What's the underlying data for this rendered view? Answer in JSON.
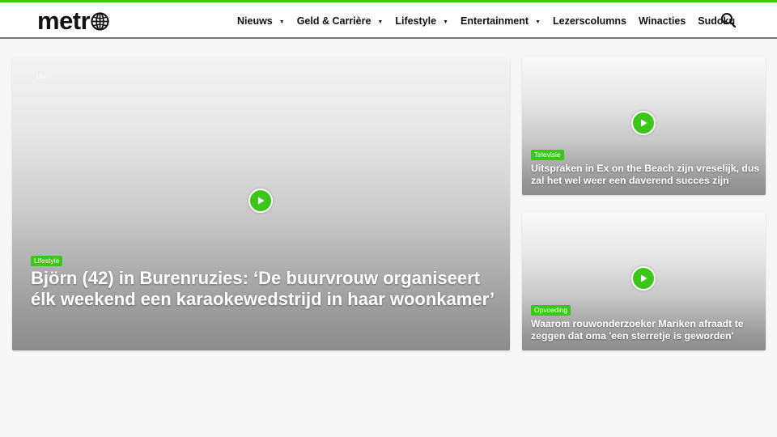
{
  "header": {
    "logo_text": "metr",
    "nav": [
      {
        "label": "Nieuws",
        "dropdown": true
      },
      {
        "label": "Geld & Carrière",
        "dropdown": true
      },
      {
        "label": "Lifestyle",
        "dropdown": true
      },
      {
        "label": "Entertainment",
        "dropdown": true
      },
      {
        "label": "Lezerscolumns",
        "dropdown": false
      },
      {
        "label": "Winacties",
        "dropdown": false
      },
      {
        "label": "Sudoku",
        "dropdown": false
      }
    ],
    "search_icon": "search-icon",
    "caret": "▼"
  },
  "colors": {
    "accent": "#3cc51a",
    "header_bg": "#ffffff",
    "page_bg": "#f7f7f7"
  },
  "main": {
    "featured": {
      "overlay_text": "Uw",
      "category": "Lifestyle",
      "title": "Björn (42) in Burenruzies: ‘De buurvrouw organiseert élk weekend een karaokewedstrijd in haar woonkamer’",
      "icon": "play-icon"
    },
    "side": [
      {
        "category": "Televisie",
        "title": "Uitspraken in Ex on the Beach zijn vreselijk, dus zal het wel weer een daverend succes zijn",
        "icon": "play-icon"
      },
      {
        "category": "Opvoeding",
        "title": "Waarom rouwonderzoeker Mariken afraadt te zeggen dat oma 'een sterretje is geworden'",
        "icon": "play-icon"
      }
    ]
  }
}
